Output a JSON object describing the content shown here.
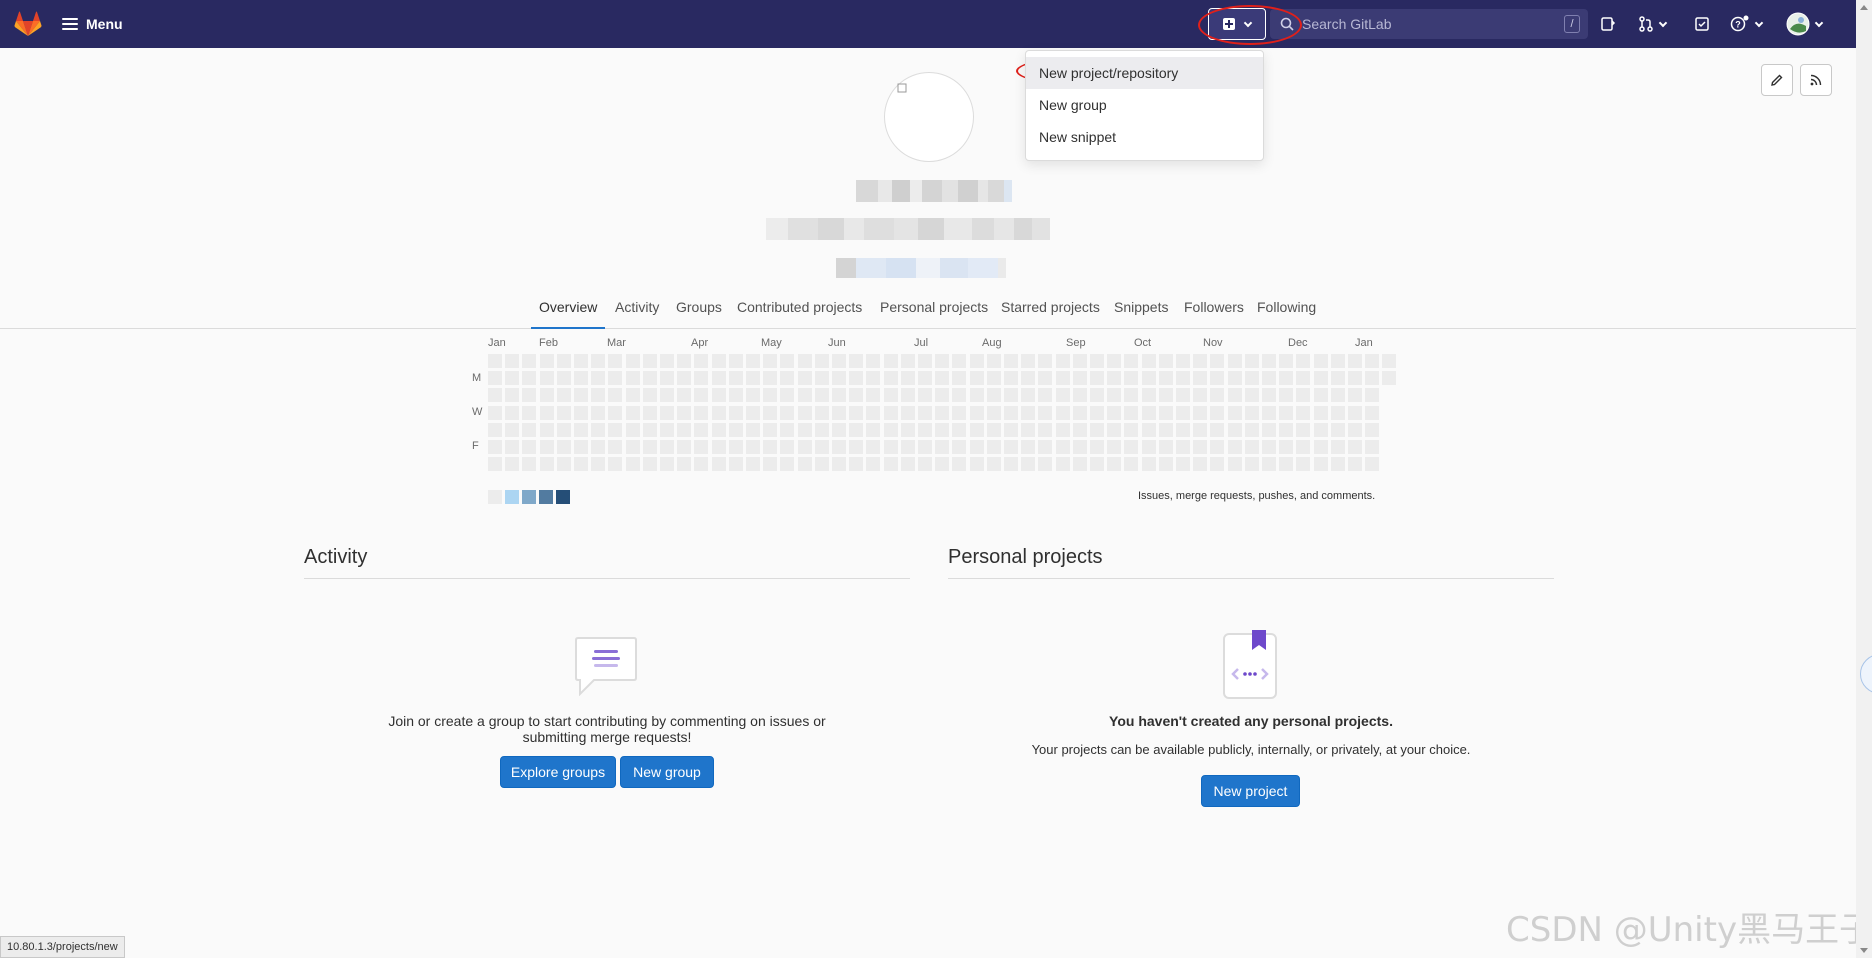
{
  "navbar": {
    "menu_label": "Menu",
    "search_placeholder": "Search GitLab",
    "search_shortcut": "/"
  },
  "new_dropdown": {
    "items": [
      {
        "label": "New project/repository"
      },
      {
        "label": "New group"
      },
      {
        "label": "New snippet"
      }
    ]
  },
  "tabs": [
    {
      "label": "Overview"
    },
    {
      "label": "Activity"
    },
    {
      "label": "Groups"
    },
    {
      "label": "Contributed projects"
    },
    {
      "label": "Personal projects"
    },
    {
      "label": "Starred projects"
    },
    {
      "label": "Snippets"
    },
    {
      "label": "Followers"
    },
    {
      "label": "Following"
    }
  ],
  "calendar": {
    "months": [
      "Jan",
      "Feb",
      "Mar",
      "Apr",
      "May",
      "Jun",
      "Jul",
      "Aug",
      "Sep",
      "Oct",
      "Nov",
      "Dec",
      "Jan"
    ],
    "day_labels": [
      "M",
      "W",
      "F"
    ],
    "caption": "Issues, merge requests, pushes, and comments.",
    "legend_colors": [
      "#ececec",
      "#acd5f2",
      "#7fa8c9",
      "#527ba0",
      "#254e77"
    ]
  },
  "activity": {
    "title": "Activity",
    "empty_line1": "Join or create a group to start contributing by commenting on issues or",
    "empty_line2": "submitting merge requests!",
    "explore_button": "Explore groups",
    "new_group_button": "New group"
  },
  "personal_projects": {
    "title": "Personal projects",
    "empty_title": "You haven't created any personal projects.",
    "empty_desc": "Your projects can be available publicly, internally, or privately, at your choice.",
    "new_project_button": "New project"
  },
  "status_bar": {
    "url": "10.80.1.3/projects/new"
  },
  "watermark": "CSDN @Unity黑马王子",
  "colors": {
    "navbar": "#292961",
    "primary": "#1f75cb",
    "annotation": "#e0201a"
  }
}
